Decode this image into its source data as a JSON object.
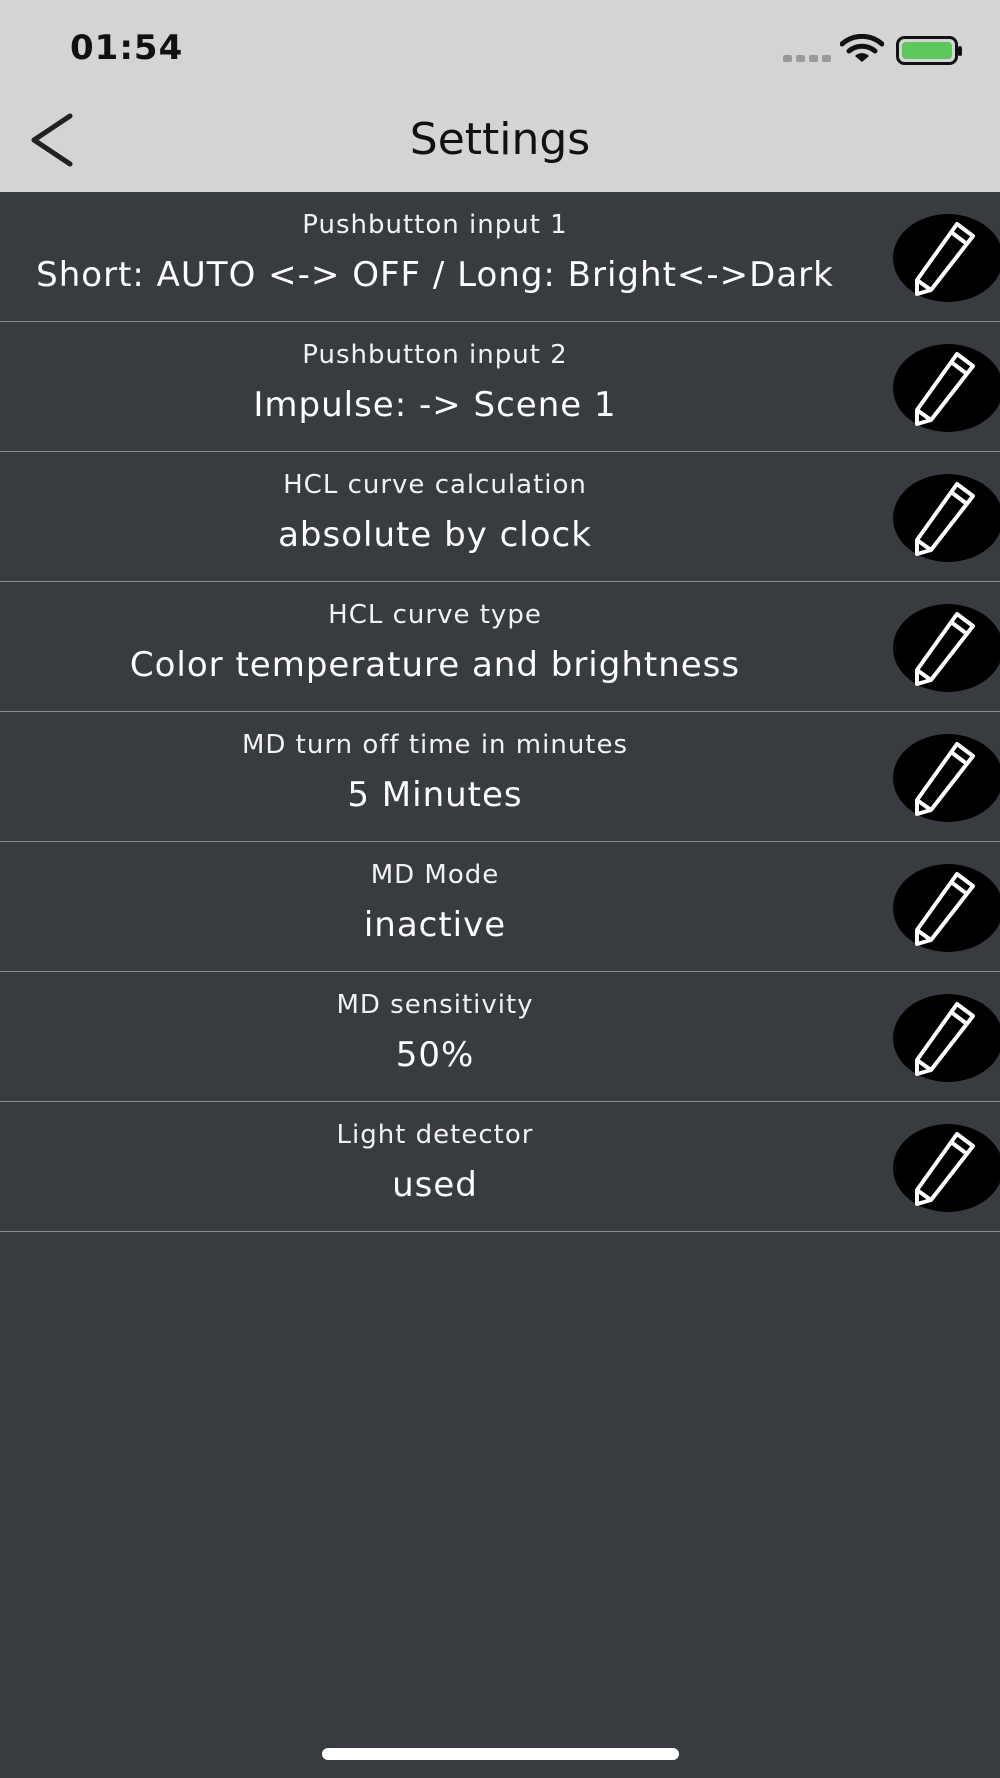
{
  "status_bar": {
    "time": "01:54"
  },
  "nav": {
    "title": "Settings",
    "back_icon": "chevron-left-icon"
  },
  "settings": [
    {
      "label": "Pushbutton input 1",
      "value": "Short: AUTO <-> OFF / Long: Bright<->Dark"
    },
    {
      "label": "Pushbutton input 2",
      "value": "Impulse: -> Scene 1"
    },
    {
      "label": "HCL curve calculation",
      "value": "absolute by clock"
    },
    {
      "label": "HCL curve type",
      "value": "Color temperature and brightness"
    },
    {
      "label": "MD turn off time in minutes",
      "value": "5 Minutes"
    },
    {
      "label": "MD Mode",
      "value": "inactive"
    },
    {
      "label": "MD sensitivity",
      "value": "50%"
    },
    {
      "label": "Light detector",
      "value": "used"
    }
  ],
  "colors": {
    "header_bg": "#d4d4d6",
    "list_bg": "#383b40",
    "battery": "#5cc75a",
    "edit_button": "#000000"
  }
}
